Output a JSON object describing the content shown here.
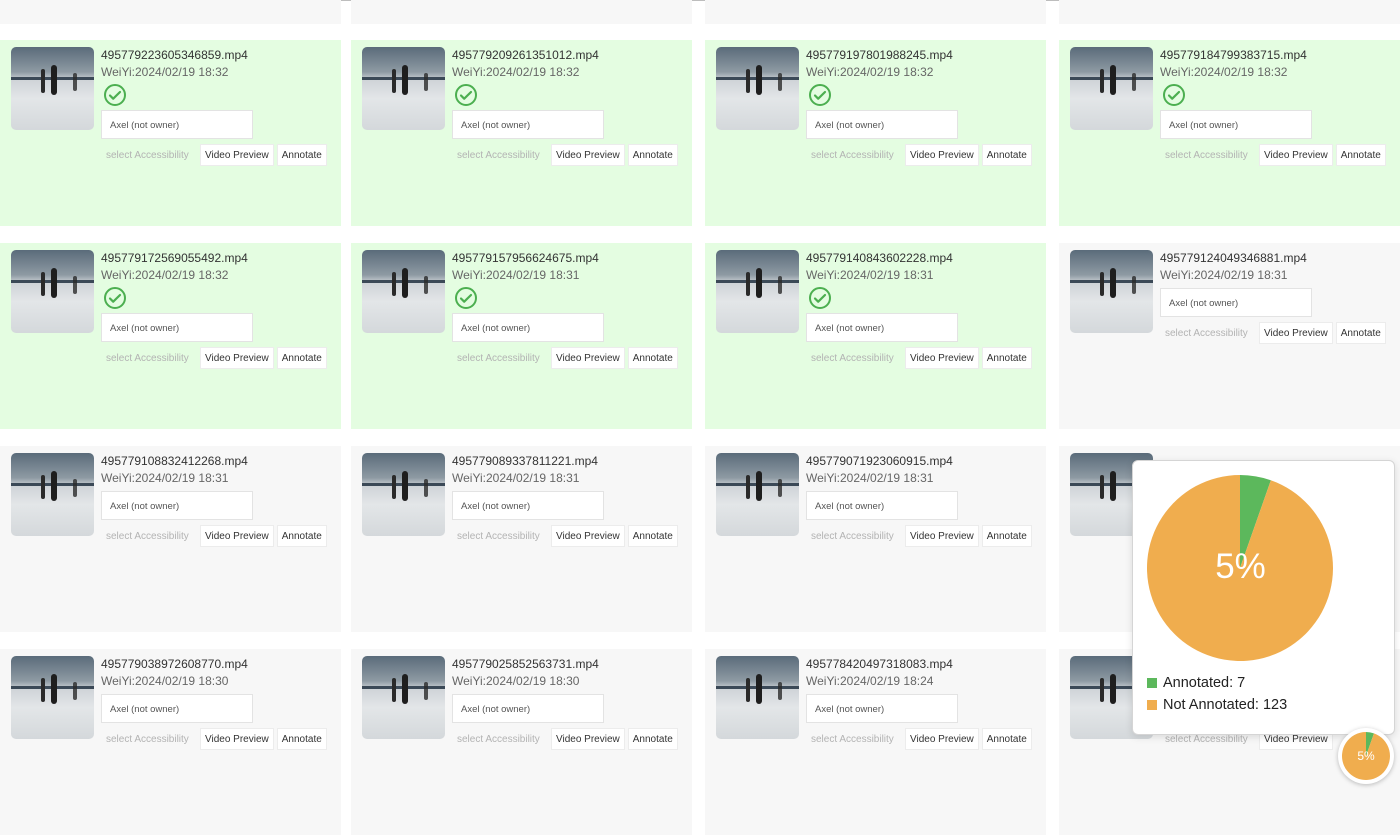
{
  "colors": {
    "annotated_bg": "#e4fde1",
    "default_bg": "#f7f7f7",
    "check": "#4caf50",
    "pie_annotated": "#5cb85c",
    "pie_not_annotated": "#f0ad4e"
  },
  "videos": [
    {
      "file": "495779223605346859.mp4",
      "meta": "WeiYi:2024/02/19 18:32",
      "annotated": true,
      "owner": "Axel (not owner)",
      "accessibility": "select Accessibility",
      "preview": "Video Preview",
      "annotate": "Annotate"
    },
    {
      "file": "495779209261351012.mp4",
      "meta": "WeiYi:2024/02/19 18:32",
      "annotated": true,
      "owner": "Axel (not owner)",
      "accessibility": "select Accessibility",
      "preview": "Video Preview",
      "annotate": "Annotate"
    },
    {
      "file": "495779197801988245.mp4",
      "meta": "WeiYi:2024/02/19 18:32",
      "annotated": true,
      "owner": "Axel (not owner)",
      "accessibility": "select Accessibility",
      "preview": "Video Preview",
      "annotate": "Annotate"
    },
    {
      "file": "495779184799383715.mp4",
      "meta": "WeiYi:2024/02/19 18:32",
      "annotated": true,
      "owner": "Axel (not owner)",
      "accessibility": "select Accessibility",
      "preview": "Video Preview",
      "annotate": "Annotate"
    },
    {
      "file": "495779172569055492.mp4",
      "meta": "WeiYi:2024/02/19 18:32",
      "annotated": true,
      "owner": "Axel (not owner)",
      "accessibility": "select Accessibility",
      "preview": "Video Preview",
      "annotate": "Annotate"
    },
    {
      "file": "495779157956624675.mp4",
      "meta": "WeiYi:2024/02/19 18:31",
      "annotated": true,
      "owner": "Axel (not owner)",
      "accessibility": "select Accessibility",
      "preview": "Video Preview",
      "annotate": "Annotate"
    },
    {
      "file": "495779140843602228.mp4",
      "meta": "WeiYi:2024/02/19 18:31",
      "annotated": true,
      "owner": "Axel (not owner)",
      "accessibility": "select Accessibility",
      "preview": "Video Preview",
      "annotate": "Annotate"
    },
    {
      "file": "495779124049346881.mp4",
      "meta": "WeiYi:2024/02/19 18:31",
      "annotated": false,
      "owner": "Axel (not owner)",
      "accessibility": "select Accessibility",
      "preview": "Video Preview",
      "annotate": "Annotate"
    },
    {
      "file": "495779108832412268.mp4",
      "meta": "WeiYi:2024/02/19 18:31",
      "annotated": false,
      "owner": "Axel (not owner)",
      "accessibility": "select Accessibility",
      "preview": "Video Preview",
      "annotate": "Annotate"
    },
    {
      "file": "495779089337811221.mp4",
      "meta": "WeiYi:2024/02/19 18:31",
      "annotated": false,
      "owner": "Axel (not owner)",
      "accessibility": "select Accessibility",
      "preview": "Video Preview",
      "annotate": "Annotate"
    },
    {
      "file": "495779071923060915.mp4",
      "meta": "WeiYi:2024/02/19 18:31",
      "annotated": false,
      "owner": "Axel (not owner)",
      "accessibility": "select Accessibility",
      "preview": "Video Preview",
      "annotate": "Annotate"
    },
    {
      "file": "",
      "meta": "",
      "annotated": false,
      "owner": "",
      "accessibility": "",
      "preview": "",
      "annotate": ""
    },
    {
      "file": "495779038972608770.mp4",
      "meta": "WeiYi:2024/02/19 18:30",
      "annotated": false,
      "owner": "Axel (not owner)",
      "accessibility": "select Accessibility",
      "preview": "Video Preview",
      "annotate": "Annotate"
    },
    {
      "file": "495779025852563731.mp4",
      "meta": "WeiYi:2024/02/19 18:30",
      "annotated": false,
      "owner": "Axel (not owner)",
      "accessibility": "select Accessibility",
      "preview": "Video Preview",
      "annotate": "Annotate"
    },
    {
      "file": "495778420497318083.mp4",
      "meta": "WeiYi:2024/02/19 18:24",
      "annotated": false,
      "owner": "Axel (not owner)",
      "accessibility": "select Accessibility",
      "preview": "Video Preview",
      "annotate": "Annotate"
    },
    {
      "file": "",
      "meta": "",
      "annotated": false,
      "owner": "",
      "accessibility": "select Accessibility",
      "preview": "Video Preview",
      "annotate": ""
    }
  ],
  "stats_popup": {
    "percent_label": "5%",
    "legend": [
      {
        "label": "Annotated: 7",
        "color": "#5cb85c"
      },
      {
        "label": "Not Annotated: 123",
        "color": "#f0ad4e"
      }
    ]
  },
  "chart_data": {
    "type": "pie",
    "categories": [
      "Annotated",
      "Not Annotated"
    ],
    "values": [
      7,
      123
    ],
    "center_label": "5%"
  },
  "fab": {
    "percent_label": "5%"
  }
}
